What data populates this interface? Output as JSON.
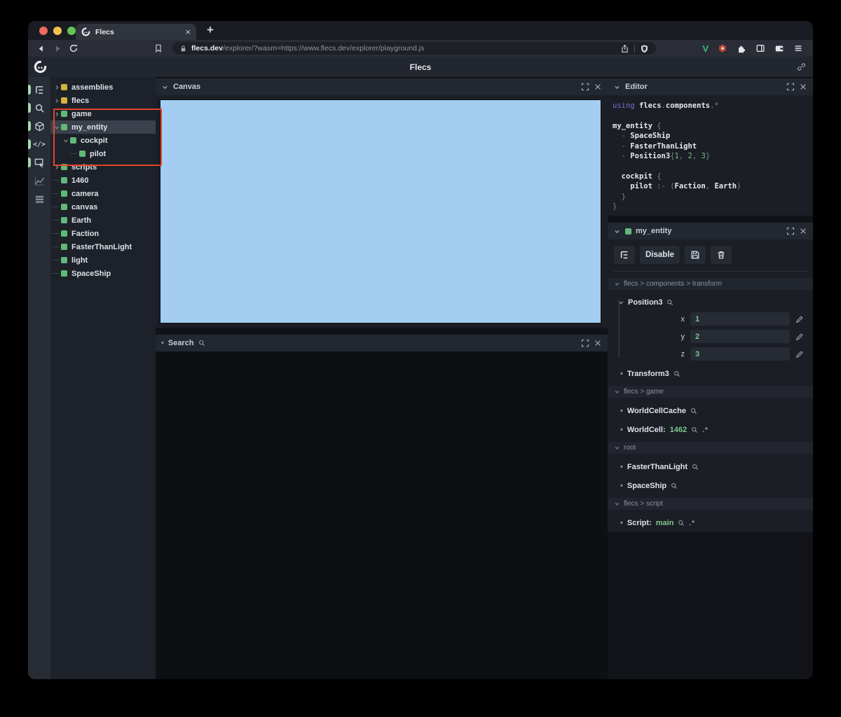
{
  "colors": {
    "traffic_red": "#ec6a5e",
    "traffic_yellow": "#f5bf4f",
    "traffic_green": "#61c454",
    "tree_green": "#62b879",
    "tree_yellow": "#d3b43e",
    "selection": "#3a414c",
    "canvas_blue": "#a3cdf1",
    "annotation_red": "#e2452c",
    "value_green": "#7fc88b",
    "ext_v_green": "#42b883",
    "ext_hexagon_red": "#b8453a"
  },
  "glyphs": {
    "close": "×",
    "plus": "+",
    "code_icon": "</>",
    "wildcard": ".*",
    "bullet": "•"
  },
  "browser": {
    "tab_title": "Flecs",
    "url_domain": "flecs.dev",
    "url_path": "/explorer/?wasm=https://www.flecs.dev/explorer/playground.js"
  },
  "app": {
    "header_title": "Flecs"
  },
  "sidebar": {
    "items": [
      {
        "icon": "tree-icon",
        "active": true
      },
      {
        "icon": "search-icon",
        "active": true
      },
      {
        "icon": "cube-icon",
        "active": true
      },
      {
        "icon": "code-icon",
        "active": true
      },
      {
        "icon": "canvas-icon",
        "active": true
      },
      {
        "icon": "chart-icon",
        "active": false
      },
      {
        "icon": "rows-icon",
        "active": false
      }
    ]
  },
  "tree": {
    "items": [
      {
        "label": "assemblies",
        "square": "yellow",
        "state": "collapsed",
        "depth": 0,
        "selected": false
      },
      {
        "label": "flecs",
        "square": "yellow",
        "state": "collapsed",
        "depth": 0,
        "selected": false
      },
      {
        "label": "game",
        "square": "green",
        "state": "collapsed",
        "depth": 0,
        "selected": false
      },
      {
        "label": "my_entity",
        "square": "green",
        "state": "expanded",
        "depth": 0,
        "selected": true
      },
      {
        "label": "cockpit",
        "square": "green",
        "state": "expanded",
        "depth": 1,
        "selected": false
      },
      {
        "label": "pilot",
        "square": "green",
        "state": "leaf",
        "depth": 2,
        "selected": false
      },
      {
        "label": "scripts",
        "square": "green",
        "state": "collapsed",
        "depth": 0,
        "selected": false
      },
      {
        "label": "1460",
        "square": "green",
        "state": "leaf",
        "depth": 0,
        "selected": false
      },
      {
        "label": "camera",
        "square": "green",
        "state": "leaf",
        "depth": 0,
        "selected": false
      },
      {
        "label": "canvas",
        "square": "green",
        "state": "leaf",
        "depth": 0,
        "selected": false
      },
      {
        "label": "Earth",
        "square": "green",
        "state": "leaf",
        "depth": 0,
        "selected": false
      },
      {
        "label": "Faction",
        "square": "green",
        "state": "leaf",
        "depth": 0,
        "selected": false
      },
      {
        "label": "FasterThanLight",
        "square": "green",
        "state": "leaf",
        "depth": 0,
        "selected": false
      },
      {
        "label": "light",
        "square": "green",
        "state": "leaf",
        "depth": 0,
        "selected": false
      },
      {
        "label": "SpaceShip",
        "square": "green",
        "state": "leaf",
        "depth": 0,
        "selected": false
      }
    ]
  },
  "canvas_panel": {
    "title": "Canvas"
  },
  "search_panel": {
    "title": "Search"
  },
  "editor_panel": {
    "title": "Editor",
    "code_lines": [
      [
        {
          "t": "using ",
          "c": "kw"
        },
        {
          "t": "flecs",
          "c": "id"
        },
        {
          "t": ".",
          "c": "p"
        },
        {
          "t": "components",
          "c": "id"
        },
        {
          "t": ".*",
          "c": "p"
        }
      ],
      [],
      [
        {
          "t": "my_entity",
          "c": "id"
        },
        {
          "t": " {",
          "c": "p"
        }
      ],
      [
        {
          "t": "  - ",
          "c": "p"
        },
        {
          "t": "SpaceShip",
          "c": "id"
        }
      ],
      [
        {
          "t": "  - ",
          "c": "p"
        },
        {
          "t": "FasterThanLight",
          "c": "id"
        }
      ],
      [
        {
          "t": "  - ",
          "c": "p"
        },
        {
          "t": "Position3",
          "c": "id"
        },
        {
          "t": "{",
          "c": "p"
        },
        {
          "t": "1",
          "c": "num"
        },
        {
          "t": ", ",
          "c": "p"
        },
        {
          "t": "2",
          "c": "num"
        },
        {
          "t": ", ",
          "c": "p"
        },
        {
          "t": "3",
          "c": "num"
        },
        {
          "t": "}",
          "c": "p"
        }
      ],
      [],
      [
        {
          "t": "  ",
          "c": "p"
        },
        {
          "t": "cockpit",
          "c": "id"
        },
        {
          "t": " {",
          "c": "p"
        }
      ],
      [
        {
          "t": "    ",
          "c": "p"
        },
        {
          "t": "pilot",
          "c": "id"
        },
        {
          "t": " :- ",
          "c": "p"
        },
        {
          "t": "(",
          "c": "p"
        },
        {
          "t": "Faction",
          "c": "id"
        },
        {
          "t": ", ",
          "c": "p"
        },
        {
          "t": "Earth",
          "c": "id"
        },
        {
          "t": ")",
          "c": "p"
        }
      ],
      [
        {
          "t": "  }",
          "c": "p"
        }
      ],
      [
        {
          "t": "}",
          "c": "p"
        }
      ]
    ]
  },
  "inspector": {
    "title": "my_entity",
    "buttons": [
      {
        "icon": "tree-icon",
        "label": ""
      },
      {
        "icon": "",
        "label": "Disable"
      },
      {
        "icon": "save-icon",
        "label": ""
      },
      {
        "icon": "trash-icon",
        "label": ""
      }
    ],
    "groups": [
      {
        "header": "flecs > components > transform",
        "items": [
          {
            "kind": "expanded",
            "label": "Position3",
            "fields": [
              {
                "name": "x",
                "value": "1"
              },
              {
                "name": "y",
                "value": "2"
              },
              {
                "name": "z",
                "value": "3"
              }
            ]
          },
          {
            "kind": "bullet",
            "label": "Transform3",
            "value": "",
            "wildcard": false
          }
        ]
      },
      {
        "header": "flecs > game",
        "items": [
          {
            "kind": "bullet",
            "label": "WorldCellCache",
            "value": "",
            "wildcard": false
          },
          {
            "kind": "bullet",
            "label": "WorldCell:",
            "value": "1462",
            "wildcard": true
          }
        ]
      },
      {
        "header": "root",
        "items": [
          {
            "kind": "bullet",
            "label": "FasterThanLight",
            "value": "",
            "wildcard": false
          },
          {
            "kind": "bullet",
            "label": "SpaceShip",
            "value": "",
            "wildcard": false
          }
        ]
      },
      {
        "header": "flecs > script",
        "items": [
          {
            "kind": "bullet",
            "label": "Script:",
            "value": "main",
            "wildcard": true
          }
        ]
      }
    ]
  }
}
